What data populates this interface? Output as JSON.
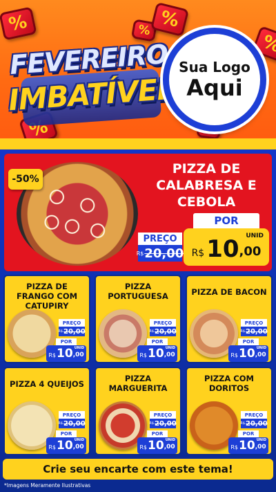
{
  "header": {
    "title_line1": "FEVEREIRO",
    "title_line2": "IMBATÍVEL",
    "logo_line1": "Sua Logo",
    "logo_line2": "Aqui",
    "percent_symbol": "%"
  },
  "featured": {
    "discount": "-50%",
    "name": "PIZZA DE CALABRESA E CEBOLA",
    "preco_label": "PREÇO",
    "old_currency": "R$",
    "old_price": "20,00",
    "por_label": "POR",
    "currency": "R$",
    "price_int": "10",
    "price_dec": ",00",
    "unit": "UNID"
  },
  "cards": [
    {
      "name": "PIZZA DE FRANGO COM CATUPIRY",
      "preco_label": "PREÇO",
      "old_currency": "R$",
      "old_price": "20,00",
      "por_label": "POR",
      "currency": "R$",
      "price_int": "10",
      "price_dec": ",00",
      "unit": "UNID"
    },
    {
      "name": "PIZZA PORTUGUESA",
      "preco_label": "PREÇO",
      "old_currency": "R$",
      "old_price": "20,00",
      "por_label": "POR",
      "currency": "R$",
      "price_int": "10",
      "price_dec": ",00",
      "unit": "UNID"
    },
    {
      "name": "PIZZA DE BACON",
      "preco_label": "PREÇO",
      "old_currency": "R$",
      "old_price": "20,00",
      "por_label": "POR",
      "currency": "R$",
      "price_int": "10",
      "price_dec": ",00",
      "unit": "UNID"
    },
    {
      "name": "PIZZA 4 QUEIJOS",
      "preco_label": "PREÇO",
      "old_currency": "R$",
      "old_price": "20,00",
      "por_label": "POR",
      "currency": "R$",
      "price_int": "10",
      "price_dec": ",00",
      "unit": "UNID"
    },
    {
      "name": "PIZZA MARGUERITA",
      "preco_label": "PREÇO",
      "old_currency": "R$",
      "old_price": "20,00",
      "por_label": "POR",
      "currency": "R$",
      "price_int": "10",
      "price_dec": ",00",
      "unit": "UNID"
    },
    {
      "name": "PIZZA COM DORITOS",
      "preco_label": "PREÇO",
      "old_currency": "R$",
      "old_price": "20,00",
      "por_label": "POR",
      "currency": "R$",
      "price_int": "10",
      "price_dec": ",00",
      "unit": "UNID"
    }
  ],
  "footer": {
    "cta": "Crie seu encarte com este tema!",
    "disclaimer": "*Imagens Meramente Ilustrativas"
  },
  "colors": {
    "header_orange": "#ff6a12",
    "brand_blue": "#1d3fd6",
    "accent_yellow": "#ffd21e",
    "featured_red": "#e3141f"
  }
}
